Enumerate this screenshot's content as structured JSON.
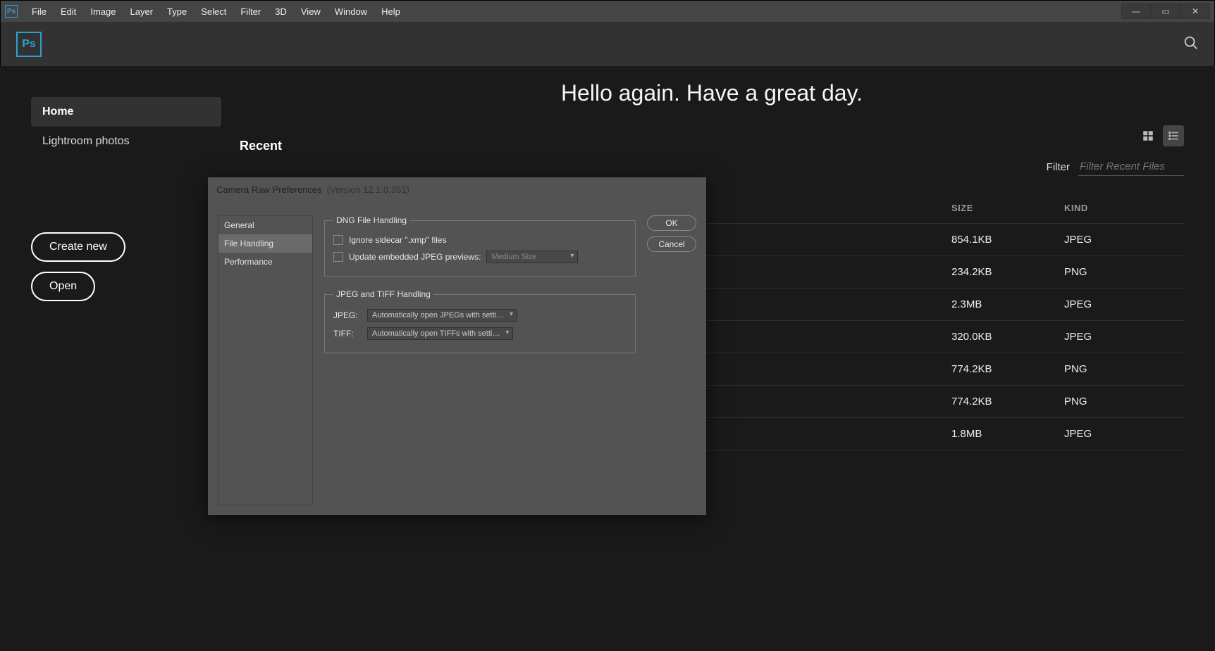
{
  "app_icon_text": "Ps",
  "menubar": [
    "File",
    "Edit",
    "Image",
    "Layer",
    "Type",
    "Select",
    "Filter",
    "3D",
    "View",
    "Window",
    "Help"
  ],
  "header": {
    "logo_text": "Ps"
  },
  "sidebar": {
    "items": [
      {
        "label": "Home",
        "active": true
      },
      {
        "label": "Lightroom photos",
        "active": false
      }
    ],
    "create_label": "Create new",
    "open_label": "Open"
  },
  "greeting": "Hello again. Have a great day.",
  "recent_label": "Recent",
  "filter_label": "Filter",
  "filter_placeholder": "Filter Recent Files",
  "table_head": {
    "size": "SIZE",
    "kind": "KIND"
  },
  "rows": [
    {
      "size": "854.1KB",
      "kind": "JPEG"
    },
    {
      "size": "234.2KB",
      "kind": "PNG"
    },
    {
      "size": "2.3MB",
      "kind": "JPEG"
    },
    {
      "size": "320.0KB",
      "kind": "JPEG"
    },
    {
      "size": "774.2KB",
      "kind": "PNG"
    },
    {
      "size": "774.2KB",
      "kind": "PNG"
    },
    {
      "size": "1.8MB",
      "kind": "JPEG"
    }
  ],
  "dialog": {
    "title": "Camera Raw Preferences",
    "version": "(Version 12.1.0.351)",
    "side": [
      "General",
      "File Handling",
      "Performance"
    ],
    "side_active": 1,
    "dng_legend": "DNG File Handling",
    "chk_ignore": "Ignore sidecar \".xmp\" files",
    "chk_update": "Update embedded JPEG previews:",
    "update_sel": "Medium Size",
    "jt_legend": "JPEG and TIFF Handling",
    "jpeg_label": "JPEG:",
    "jpeg_sel": "Automatically open JPEGs with setti…",
    "tiff_label": "TIFF:",
    "tiff_sel": "Automatically open TIFFs with setti…",
    "ok": "OK",
    "cancel": "Cancel"
  }
}
